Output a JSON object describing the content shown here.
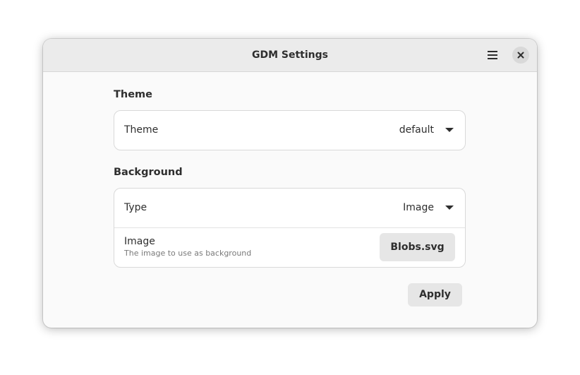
{
  "window": {
    "title": "GDM Settings"
  },
  "header": {
    "menu_icon": "hamburger-menu-icon",
    "close_icon": "close-icon"
  },
  "theme_section": {
    "title": "Theme",
    "rows": [
      {
        "label": "Theme",
        "value": "default",
        "icon": "chevron-down-icon"
      }
    ]
  },
  "background_section": {
    "title": "Background",
    "type_row": {
      "label": "Type",
      "value": "Image",
      "icon": "chevron-down-icon"
    },
    "image_row": {
      "label": "Image",
      "subtitle": "The image to use as background",
      "button_label": "Blobs.svg"
    }
  },
  "actions": {
    "apply_label": "Apply"
  }
}
